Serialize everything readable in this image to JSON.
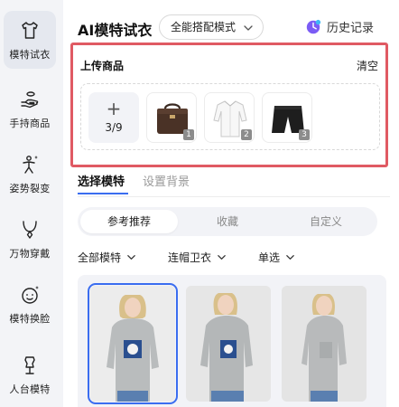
{
  "sidebar": {
    "items": [
      {
        "label": "模特试衣",
        "icon": "tshirt-icon",
        "active": true
      },
      {
        "label": "手持商品",
        "icon": "hand-holding-icon",
        "active": false
      },
      {
        "label": "姿势裂变",
        "icon": "pose-sparkle-icon",
        "active": false
      },
      {
        "label": "万物穿戴",
        "icon": "necklace-icon",
        "active": false
      },
      {
        "label": "模特换脸",
        "icon": "face-swap-icon",
        "active": false
      },
      {
        "label": "人台模特",
        "icon": "mannequin-icon",
        "active": false
      }
    ]
  },
  "header": {
    "title": "AI模特试衣",
    "mode_select": {
      "value": "全能搭配模式",
      "icon": "chevron-down-icon"
    },
    "history_label": "历史记录",
    "history_icon": "clock-moon-icon"
  },
  "upload": {
    "title": "上传商品",
    "clear_label": "清空",
    "add_symbol": "+",
    "count": "3/9",
    "items": [
      {
        "badge": "1",
        "depicts": "leather-briefcase"
      },
      {
        "badge": "2",
        "depicts": "white-shirt"
      },
      {
        "badge": "3",
        "depicts": "black-shorts"
      }
    ]
  },
  "tabs": [
    {
      "label": "选择模特",
      "active": true
    },
    {
      "label": "设置背景",
      "active": false
    }
  ],
  "segmented": [
    {
      "label": "参考推荐",
      "active": true
    },
    {
      "label": "收藏",
      "active": false
    },
    {
      "label": "自定义",
      "active": false
    }
  ],
  "filters": [
    {
      "label": "全部模特"
    },
    {
      "label": "连帽卫衣"
    },
    {
      "label": "单选"
    }
  ],
  "models": [
    {
      "selected": true
    },
    {
      "selected": false
    },
    {
      "selected": false
    }
  ],
  "colors": {
    "accent": "#3a6df0",
    "highlight_border": "#e05a63",
    "history_icon": "#7b5cf5"
  }
}
